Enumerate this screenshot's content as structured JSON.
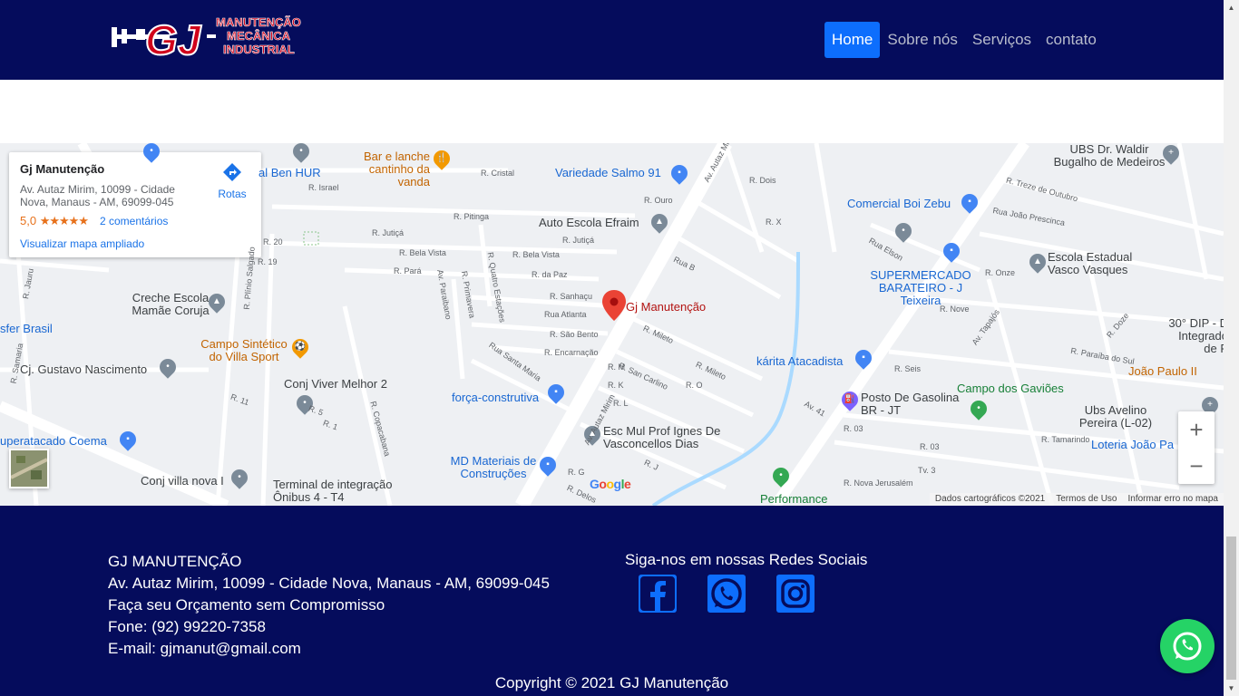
{
  "header": {
    "logo_text": "GJ",
    "logo_tagline": [
      "MANUTENÇÃO",
      "MECÂNICA",
      "INDUSTRIAL"
    ],
    "nav": [
      {
        "label": "Home",
        "active": true
      },
      {
        "label": "Sobre nós",
        "active": false
      },
      {
        "label": "Serviços",
        "active": false
      },
      {
        "label": "contato",
        "active": false
      }
    ]
  },
  "map": {
    "info_card": {
      "title": "Gj Manutenção",
      "address": "Av. Autaz Mirim, 10099 - Cidade Nova, Manaus - AM, 69099-045",
      "rating": "5,0",
      "stars": "★★★★★",
      "reviews": "2 comentários",
      "large_map_link": "Visualizar mapa ampliado",
      "directions_label": "Rotas"
    },
    "marker_label": "Gj Manutenção",
    "places": [
      "Bar e lanche cantinho da vanda",
      "Variedade Salmo 91",
      "UBS Dr. Waldir Bugalho de Medeiros",
      "Comercial Boi Zebu",
      "Auto Escola Efraim",
      "Escola Estadual Vasco Vasques",
      "SUPERMERCADO BARATEIRO - J Teixeira",
      "Creche Escola Mamãe Coruja",
      "sfer Brasil",
      "Campo Sintético do Villa Sport",
      "Cj. Gustavo Nascimento",
      "Conj Viver Melhor 2",
      "força-construtiva",
      "kárita Atacadista",
      "30° DIP - D Integrado de P",
      "João Paulo II",
      "Campo dos Gaviões",
      "Posto De Gasolina BR - JT",
      "Ubs Avelino Pereira (L-02)",
      "Loteria João Pa",
      "Esc Mul Prof Ignes De Vasconcellos Dias",
      "uperatacado Coema",
      "MD Materiais de Construções",
      "Conj villa nova I",
      "Terminal de integração Ônibus 4 - T4",
      "Performance",
      "al Ben HUR"
    ],
    "streets": [
      "Av. Autaz Mirim",
      "R. Cristal",
      "R. Israel",
      "R. Pitinga",
      "R. Jutiçá",
      "R. Bela Vista",
      "R. Pará",
      "R. da Paz",
      "R. Sanhaçu",
      "Rua Atlanta",
      "R. São Bento",
      "R. Encarnação",
      "Rua Santa Maria",
      "R. Mileto",
      "R. San Carlino",
      "R. Ouro",
      "R. Dois",
      "R. X",
      "Rua B",
      "R. Onze",
      "R. Nove",
      "R. Seis",
      "R. Doze",
      "R. 03",
      "R. Tamarindo",
      "R. Nova Jerusalém",
      "Av. Tapajós",
      "Rua Elson",
      "R. Treze de Outubro",
      "Rua João Prescinca",
      "R. Paraíba do Sul",
      "Av. 41",
      "R. Copacabana",
      "R. Quatro Estações",
      "R. Primavera",
      "Av. Paraibano",
      "R. Plínio Salgado",
      "R. 19",
      "R. 20",
      "R. 11",
      "R. 5",
      "R. 1",
      "R. Jauru",
      "R. Samaria",
      "Tv. 3",
      "R. Delos",
      "R. G",
      "R. J",
      "R. K",
      "R. L",
      "R. M",
      "R. O"
    ],
    "attribution": [
      "Dados cartográficos ©2021",
      "Termos de Uso",
      "Informar erro no mapa"
    ],
    "google_logo": "Google",
    "zoom_in": "+",
    "zoom_out": "−"
  },
  "footer": {
    "company": "GJ MANUTENÇÃO",
    "address": "Av. Autaz Mirim, 10099 - Cidade Nova, Manaus - AM, 69099-045",
    "cta": "Faça seu Orçamento sem Compromisso",
    "phone": "Fone: (92) 99220-7358",
    "email": "E-mail: gjmanut@gmail.com",
    "social_title": "Siga-nos em nossas Redes Sociais",
    "social": [
      "facebook-icon",
      "whatsapp-icon",
      "instagram-icon"
    ],
    "copyright": "Copyright © 2021 GJ Manutenção"
  },
  "colors": {
    "navy": "#050c5c",
    "accent_blue": "#0d6efd",
    "whatsapp_green": "#25d366",
    "logo_red": "#d0021b"
  }
}
